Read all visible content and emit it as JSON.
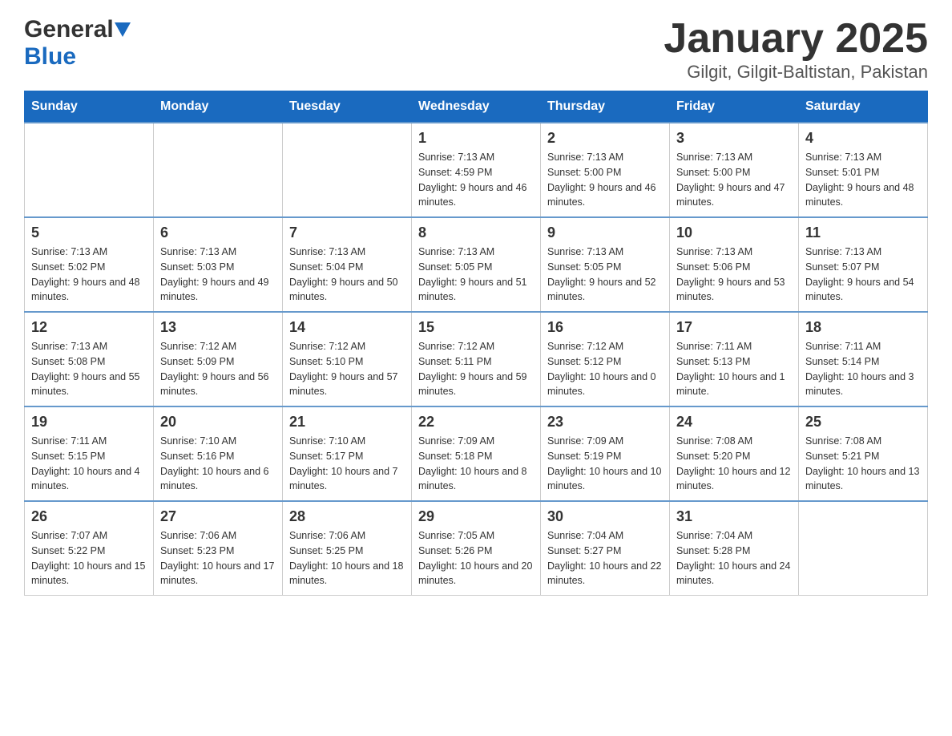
{
  "logo": {
    "general": "General",
    "blue": "Blue"
  },
  "title": "January 2025",
  "subtitle": "Gilgit, Gilgit-Baltistan, Pakistan",
  "days_of_week": [
    "Sunday",
    "Monday",
    "Tuesday",
    "Wednesday",
    "Thursday",
    "Friday",
    "Saturday"
  ],
  "weeks": [
    [
      {
        "day": "",
        "sunrise": "",
        "sunset": "",
        "daylight": ""
      },
      {
        "day": "",
        "sunrise": "",
        "sunset": "",
        "daylight": ""
      },
      {
        "day": "",
        "sunrise": "",
        "sunset": "",
        "daylight": ""
      },
      {
        "day": "1",
        "sunrise": "Sunrise: 7:13 AM",
        "sunset": "Sunset: 4:59 PM",
        "daylight": "Daylight: 9 hours and 46 minutes."
      },
      {
        "day": "2",
        "sunrise": "Sunrise: 7:13 AM",
        "sunset": "Sunset: 5:00 PM",
        "daylight": "Daylight: 9 hours and 46 minutes."
      },
      {
        "day": "3",
        "sunrise": "Sunrise: 7:13 AM",
        "sunset": "Sunset: 5:00 PM",
        "daylight": "Daylight: 9 hours and 47 minutes."
      },
      {
        "day": "4",
        "sunrise": "Sunrise: 7:13 AM",
        "sunset": "Sunset: 5:01 PM",
        "daylight": "Daylight: 9 hours and 48 minutes."
      }
    ],
    [
      {
        "day": "5",
        "sunrise": "Sunrise: 7:13 AM",
        "sunset": "Sunset: 5:02 PM",
        "daylight": "Daylight: 9 hours and 48 minutes."
      },
      {
        "day": "6",
        "sunrise": "Sunrise: 7:13 AM",
        "sunset": "Sunset: 5:03 PM",
        "daylight": "Daylight: 9 hours and 49 minutes."
      },
      {
        "day": "7",
        "sunrise": "Sunrise: 7:13 AM",
        "sunset": "Sunset: 5:04 PM",
        "daylight": "Daylight: 9 hours and 50 minutes."
      },
      {
        "day": "8",
        "sunrise": "Sunrise: 7:13 AM",
        "sunset": "Sunset: 5:05 PM",
        "daylight": "Daylight: 9 hours and 51 minutes."
      },
      {
        "day": "9",
        "sunrise": "Sunrise: 7:13 AM",
        "sunset": "Sunset: 5:05 PM",
        "daylight": "Daylight: 9 hours and 52 minutes."
      },
      {
        "day": "10",
        "sunrise": "Sunrise: 7:13 AM",
        "sunset": "Sunset: 5:06 PM",
        "daylight": "Daylight: 9 hours and 53 minutes."
      },
      {
        "day": "11",
        "sunrise": "Sunrise: 7:13 AM",
        "sunset": "Sunset: 5:07 PM",
        "daylight": "Daylight: 9 hours and 54 minutes."
      }
    ],
    [
      {
        "day": "12",
        "sunrise": "Sunrise: 7:13 AM",
        "sunset": "Sunset: 5:08 PM",
        "daylight": "Daylight: 9 hours and 55 minutes."
      },
      {
        "day": "13",
        "sunrise": "Sunrise: 7:12 AM",
        "sunset": "Sunset: 5:09 PM",
        "daylight": "Daylight: 9 hours and 56 minutes."
      },
      {
        "day": "14",
        "sunrise": "Sunrise: 7:12 AM",
        "sunset": "Sunset: 5:10 PM",
        "daylight": "Daylight: 9 hours and 57 minutes."
      },
      {
        "day": "15",
        "sunrise": "Sunrise: 7:12 AM",
        "sunset": "Sunset: 5:11 PM",
        "daylight": "Daylight: 9 hours and 59 minutes."
      },
      {
        "day": "16",
        "sunrise": "Sunrise: 7:12 AM",
        "sunset": "Sunset: 5:12 PM",
        "daylight": "Daylight: 10 hours and 0 minutes."
      },
      {
        "day": "17",
        "sunrise": "Sunrise: 7:11 AM",
        "sunset": "Sunset: 5:13 PM",
        "daylight": "Daylight: 10 hours and 1 minute."
      },
      {
        "day": "18",
        "sunrise": "Sunrise: 7:11 AM",
        "sunset": "Sunset: 5:14 PM",
        "daylight": "Daylight: 10 hours and 3 minutes."
      }
    ],
    [
      {
        "day": "19",
        "sunrise": "Sunrise: 7:11 AM",
        "sunset": "Sunset: 5:15 PM",
        "daylight": "Daylight: 10 hours and 4 minutes."
      },
      {
        "day": "20",
        "sunrise": "Sunrise: 7:10 AM",
        "sunset": "Sunset: 5:16 PM",
        "daylight": "Daylight: 10 hours and 6 minutes."
      },
      {
        "day": "21",
        "sunrise": "Sunrise: 7:10 AM",
        "sunset": "Sunset: 5:17 PM",
        "daylight": "Daylight: 10 hours and 7 minutes."
      },
      {
        "day": "22",
        "sunrise": "Sunrise: 7:09 AM",
        "sunset": "Sunset: 5:18 PM",
        "daylight": "Daylight: 10 hours and 8 minutes."
      },
      {
        "day": "23",
        "sunrise": "Sunrise: 7:09 AM",
        "sunset": "Sunset: 5:19 PM",
        "daylight": "Daylight: 10 hours and 10 minutes."
      },
      {
        "day": "24",
        "sunrise": "Sunrise: 7:08 AM",
        "sunset": "Sunset: 5:20 PM",
        "daylight": "Daylight: 10 hours and 12 minutes."
      },
      {
        "day": "25",
        "sunrise": "Sunrise: 7:08 AM",
        "sunset": "Sunset: 5:21 PM",
        "daylight": "Daylight: 10 hours and 13 minutes."
      }
    ],
    [
      {
        "day": "26",
        "sunrise": "Sunrise: 7:07 AM",
        "sunset": "Sunset: 5:22 PM",
        "daylight": "Daylight: 10 hours and 15 minutes."
      },
      {
        "day": "27",
        "sunrise": "Sunrise: 7:06 AM",
        "sunset": "Sunset: 5:23 PM",
        "daylight": "Daylight: 10 hours and 17 minutes."
      },
      {
        "day": "28",
        "sunrise": "Sunrise: 7:06 AM",
        "sunset": "Sunset: 5:25 PM",
        "daylight": "Daylight: 10 hours and 18 minutes."
      },
      {
        "day": "29",
        "sunrise": "Sunrise: 7:05 AM",
        "sunset": "Sunset: 5:26 PM",
        "daylight": "Daylight: 10 hours and 20 minutes."
      },
      {
        "day": "30",
        "sunrise": "Sunrise: 7:04 AM",
        "sunset": "Sunset: 5:27 PM",
        "daylight": "Daylight: 10 hours and 22 minutes."
      },
      {
        "day": "31",
        "sunrise": "Sunrise: 7:04 AM",
        "sunset": "Sunset: 5:28 PM",
        "daylight": "Daylight: 10 hours and 24 minutes."
      },
      {
        "day": "",
        "sunrise": "",
        "sunset": "",
        "daylight": ""
      }
    ]
  ]
}
